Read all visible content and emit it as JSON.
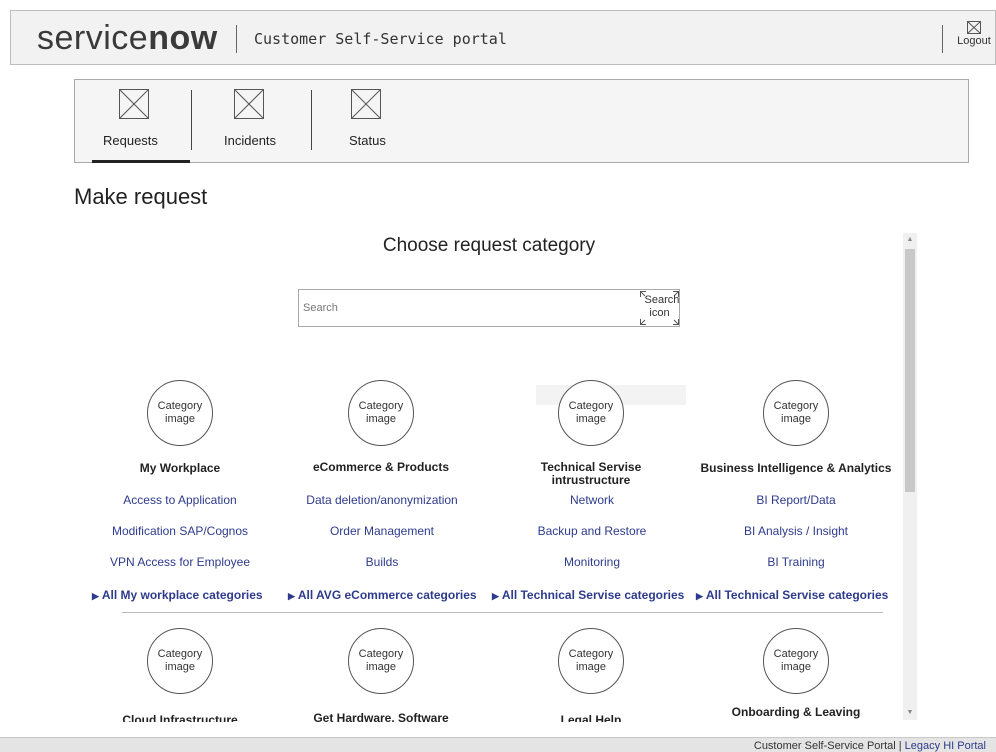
{
  "header": {
    "logo_service": "service",
    "logo_now": "now",
    "portal_title": "Customer Self-Service portal",
    "logout_label": "Logout"
  },
  "tabs": [
    {
      "label": "Requests",
      "active": true
    },
    {
      "label": "Incidents",
      "active": false
    },
    {
      "label": "Status",
      "active": false
    }
  ],
  "page_title": "Make request",
  "main": {
    "heading": "Choose request category",
    "search": {
      "placeholder": "Search",
      "value": "",
      "button_label": "Search icon"
    },
    "category_image_label": "Category\nimage",
    "categories_row1": [
      {
        "title": "My Workplace",
        "links": [
          "Access to Application",
          "Modification SAP/Cognos",
          "VPN Access for Employee"
        ],
        "all": "All My workplace categories"
      },
      {
        "title": "eCommerce & Products",
        "links": [
          "Data deletion/anonymization",
          "Order Management",
          "Builds"
        ],
        "all": "All AVG eCommerce categories"
      },
      {
        "title": "Technical Servise intrustructure",
        "links": [
          "Network",
          "Backup and Restore",
          "Monitoring"
        ],
        "all": "All Technical Servise categories"
      },
      {
        "title": "Business Intelligence & Analytics",
        "links": [
          "BI Report/Data",
          "BI Analysis / Insight",
          "BI Training"
        ],
        "all": "All Technical Servise categories"
      }
    ],
    "categories_row2": [
      {
        "title": "Cloud Infrastructure"
      },
      {
        "title": "Get Hardware, Software"
      },
      {
        "title": "Legal Help"
      },
      {
        "title": "Onboarding & Leaving"
      }
    ]
  },
  "footer": {
    "text": "Customer Self-Service Portal | ",
    "link": "Legacy HI Portal"
  },
  "icons": {
    "placeholder": "image-placeholder-icon",
    "arrow": "triangle-right-icon"
  },
  "colors": {
    "link": "#2e3b8c",
    "header_bg": "#f2f2f2"
  }
}
